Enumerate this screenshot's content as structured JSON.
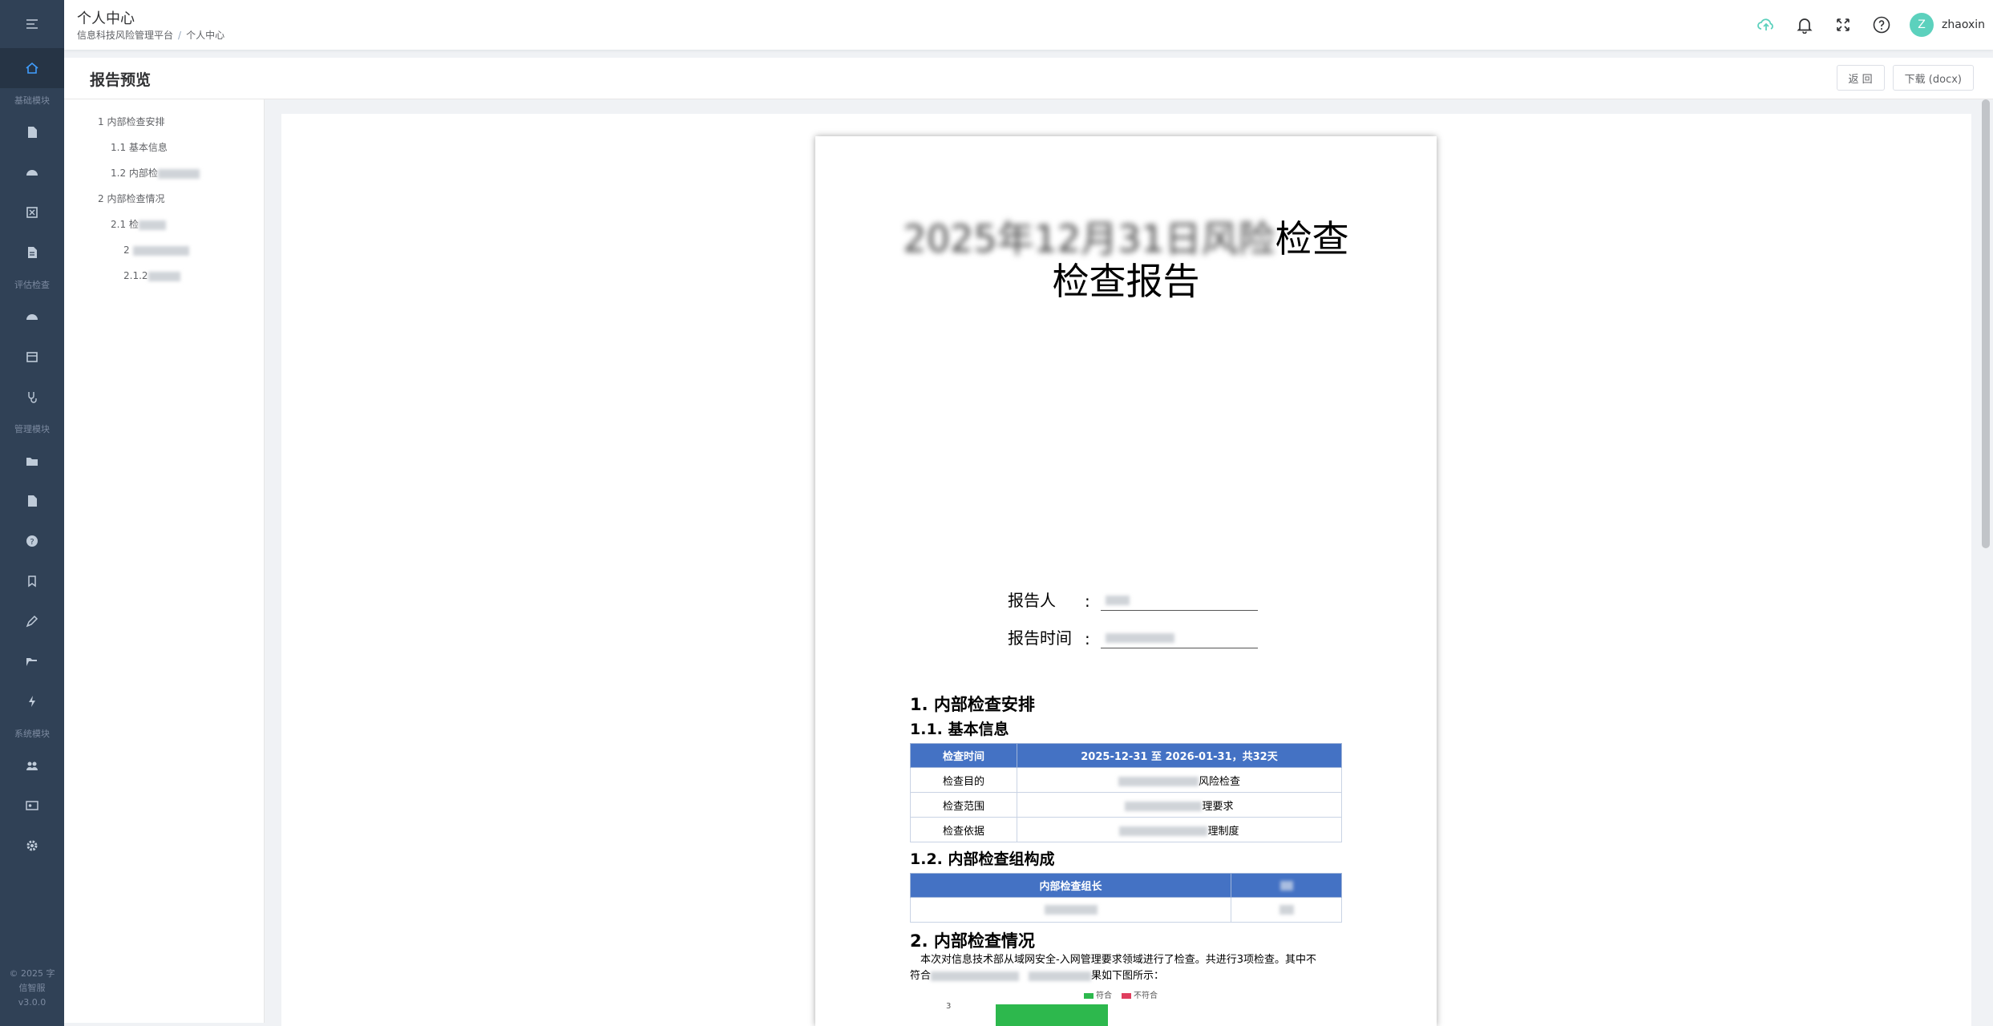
{
  "sidebar": {
    "groups": [
      "基础模块",
      "评估检查",
      "管理模块",
      "系统模块"
    ],
    "footer_line1": "© 2025 字",
    "footer_line2": "信智服",
    "version": "v3.0.0"
  },
  "topbar": {
    "title": "个人中心",
    "breadcrumb": [
      "信息科技风险管理平台",
      "个人中心"
    ],
    "breadcrumb_sep": "/",
    "avatar_letter": "Z",
    "username": "zhaoxin",
    "accent_color": "#5cd1bd"
  },
  "page_header": {
    "title": "报告预览",
    "back_label": "返 回",
    "download_label": "下载 (docx)"
  },
  "toc": {
    "items": [
      "1 内部检查安排",
      "1.1 基本信息",
      "1.2 内部检",
      "2 内部检查情况",
      "2.1 检",
      "2",
      "2.1.2"
    ]
  },
  "document": {
    "title_line1_visible": "检查",
    "title_line1_blurred": "2025年12月31日风险",
    "title_line2": "检查报告",
    "reporter_label": "报告人",
    "report_time_label": "报告时间",
    "colon": ":",
    "section1": "1. 内部检查安排",
    "section1_1": "1.1. 基本信息",
    "basic_table": {
      "header_label": "检查时间",
      "header_value": "2025-12-31 至 2026-01-31，共32天",
      "rows": [
        {
          "label": "检查目的",
          "value_suffix": "风险检查"
        },
        {
          "label": "检查范围",
          "value_suffix": "理要求"
        },
        {
          "label": "检查依据",
          "value_suffix": "理制度"
        }
      ]
    },
    "section1_2": "1.2. 内部检查组构成",
    "team_table": {
      "header": "内部检查组长"
    },
    "section2": "2. 内部检查情况",
    "para_line1": "本次对信息技术部从域网安全-入网管理要求领域进行了检查。共进行3项检查。其中不",
    "para_line2_prefix": "符合",
    "para_line2_suffix": "果如下图所示：",
    "legend": [
      "符合",
      "不符合"
    ],
    "legend_colors": [
      "#2db84d",
      "#e03e5e"
    ],
    "chart_tick": "3"
  }
}
